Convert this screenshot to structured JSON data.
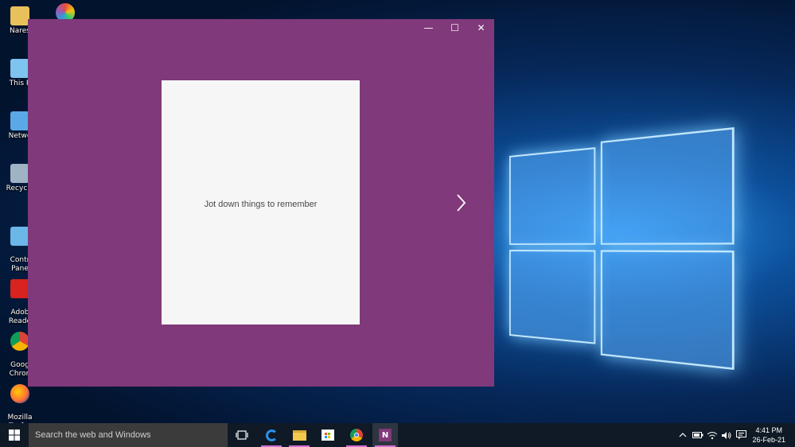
{
  "desktop": {
    "icons": [
      {
        "label": "Nares"
      },
      {
        "label": "This P"
      },
      {
        "label": "Netwo"
      },
      {
        "label": "Recycle"
      },
      {
        "label": "Contr\nPane"
      },
      {
        "label": "Adob\nReade"
      },
      {
        "label": "Goog\nChron"
      },
      {
        "label": "Mozilla\nFirefox"
      }
    ]
  },
  "window": {
    "minimize": "—",
    "maximize": "☐",
    "close": "✕",
    "card_text": "Jot down things to remember",
    "accent": "#80397b"
  },
  "taskbar": {
    "search_placeholder": "Search the web and Windows",
    "time": "4:41 PM",
    "date": "26-Feb-21"
  }
}
